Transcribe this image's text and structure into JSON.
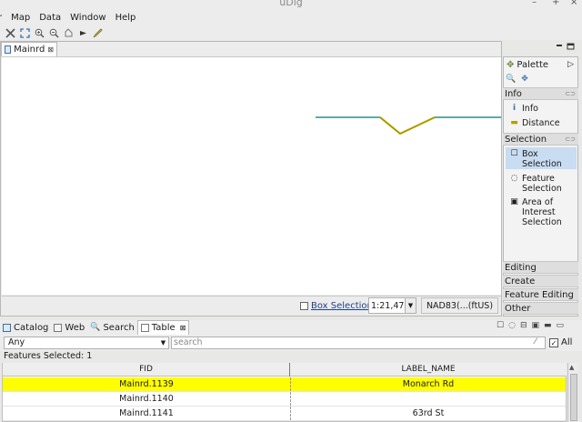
{
  "window": {
    "title": "uDig",
    "minimize_glyph": "–",
    "maximize_glyph": "+",
    "close_glyph": "×"
  },
  "menu": [
    "r",
    "Map",
    "Data",
    "Window",
    "Help"
  ],
  "toolbar_icons": [
    "selection-tool",
    "zoom-extent",
    "zoom-in",
    "zoom-out",
    "pan",
    "identify",
    "edit"
  ],
  "editor": {
    "tab_label": "Mainrd",
    "tab_close": "⊠"
  },
  "status": {
    "selection_tool_label": "Box Selection",
    "scale_value": "1:21,477",
    "crs": "NAD83(...(ftUS)"
  },
  "palette": {
    "title": "Palette",
    "drawers": [
      {
        "label": "Info",
        "tools": [
          {
            "icon": "info-icon",
            "label": "Info"
          },
          {
            "icon": "distance-icon",
            "label": "Distance"
          }
        ]
      },
      {
        "label": "Selection",
        "tools": [
          {
            "icon": "box-selection-icon",
            "label": "Box Selection",
            "active": true
          },
          {
            "icon": "feature-selection-icon",
            "label": "Feature Selection"
          },
          {
            "icon": "area-of-interest-icon",
            "label": "Area of Interest Selection"
          }
        ]
      }
    ],
    "collapsed_drawers": [
      "Editing",
      "Create",
      "Feature Editing",
      "Other"
    ]
  },
  "bottom_tabs": [
    {
      "label": "Catalog"
    },
    {
      "label": "Web"
    },
    {
      "label": "Search"
    },
    {
      "label": "Table",
      "selected": true,
      "close": "⊠"
    }
  ],
  "table_view": {
    "filter_value": "Any",
    "search_placeholder": "search",
    "all_label": "All",
    "all_checked": "✓",
    "features_selected": "Features Selected: 1",
    "columns": [
      "FID",
      "LABEL_NAME"
    ],
    "rows": [
      {
        "fid": "Mainrd.1139",
        "label": "Monarch Rd",
        "highlighted": true
      },
      {
        "fid": "Mainrd.1140",
        "label": ""
      },
      {
        "fid": "Mainrd.1141",
        "label": "63rd St"
      }
    ]
  },
  "map": {
    "road_colors": {
      "unselected": "#2e8b8b",
      "selected": "#c8b400"
    }
  }
}
